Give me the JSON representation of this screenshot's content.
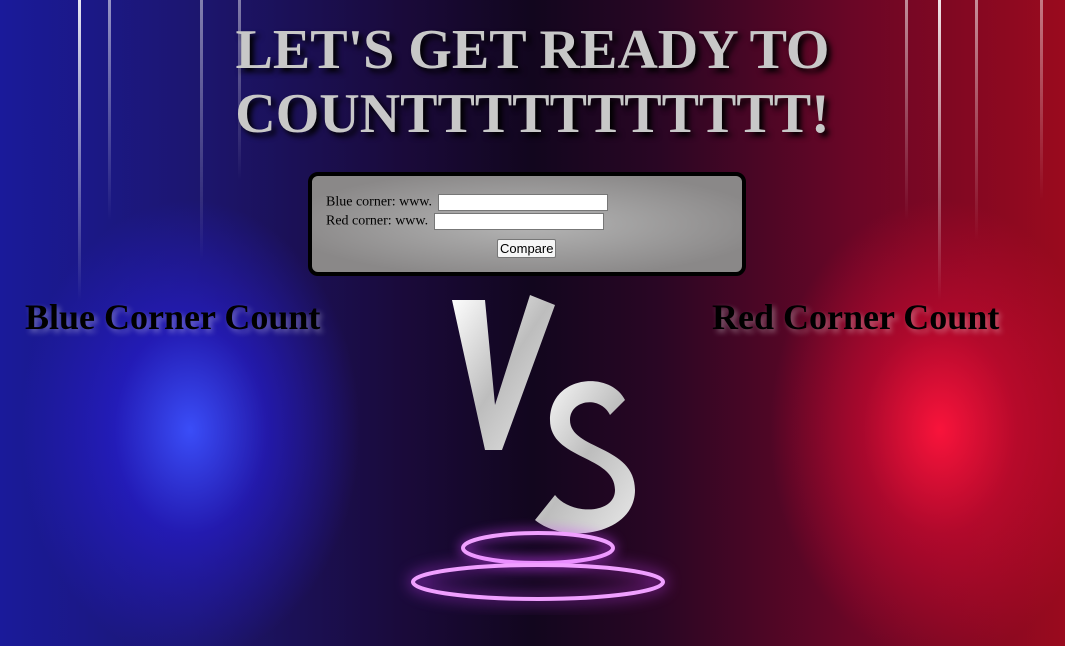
{
  "title": "LET'S GET READY TO COUNTTTTTTTTTTT!",
  "form": {
    "blue_label": "Blue corner: www.",
    "blue_value": "",
    "red_label": "Red corner: www.",
    "red_value": "",
    "compare_label": "Compare"
  },
  "blue_count_label": "Blue Corner Count",
  "red_count_label": "Red Corner Count",
  "vs_logo": "VS",
  "colors": {
    "blue": "#2a3cff",
    "red": "#ff1440",
    "title": "#c8c8c8"
  }
}
